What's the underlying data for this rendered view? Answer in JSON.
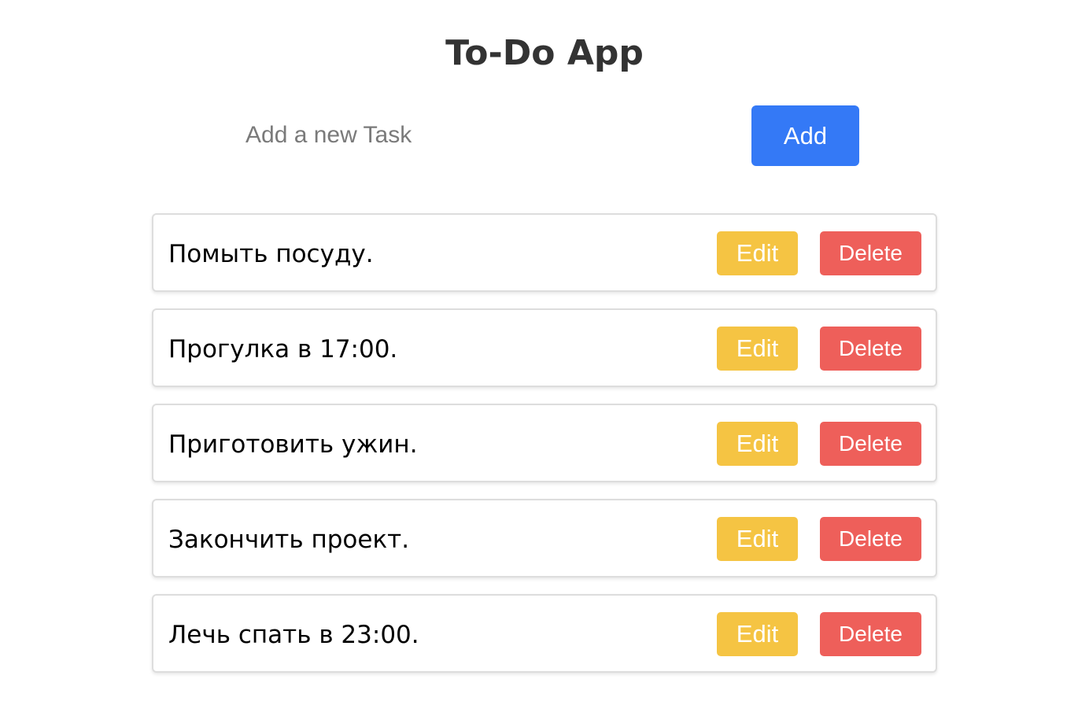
{
  "app": {
    "title": "To-Do App"
  },
  "new_task": {
    "placeholder": "Add a new Task",
    "value": "",
    "add_label": "Add"
  },
  "tasks": [
    {
      "text": "Помыть посуду.",
      "edit_label": "Edit",
      "delete_label": "Delete"
    },
    {
      "text": "Прогулка в 17:00.",
      "edit_label": "Edit",
      "delete_label": "Delete"
    },
    {
      "text": "Приготовить ужин.",
      "edit_label": "Edit",
      "delete_label": "Delete"
    },
    {
      "text": "Закончить проект.",
      "edit_label": "Edit",
      "delete_label": "Delete"
    },
    {
      "text": "Лечь спать в 23:00.",
      "edit_label": "Edit",
      "delete_label": "Delete"
    }
  ],
  "colors": {
    "title": "#333333",
    "add_button": "#3479f6",
    "edit_button": "#f5c443",
    "delete_button": "#ee5f5a",
    "task_border": "#dddddd"
  }
}
